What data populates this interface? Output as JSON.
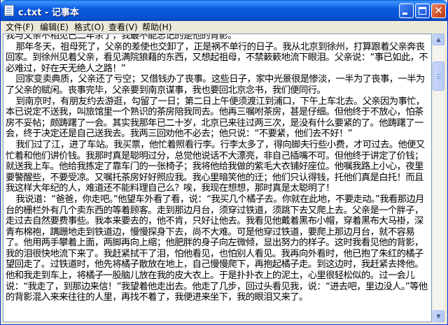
{
  "window": {
    "title": "c.txt - 记事本",
    "minimize_icon": "minimize-icon",
    "maximize_icon": "maximize-icon",
    "close_icon": "close-icon",
    "close_glyph": "✕"
  },
  "menu": {
    "items": [
      "文件(F)",
      "编辑(E)",
      "格式(O)",
      "查看(V)",
      "帮助(H)"
    ]
  },
  "document": {
    "text": "我与父亲不相见已二年余了，我最不能忘记的是他的背影。\n    那年冬天，祖母死了，父亲的差使也交卸了，正是祸不单行的日子。我从北京到徐州，打算跟着父亲奔丧回家。到徐州见着父亲，看见满院狼藉的东西，又想起祖母，不禁簌簌地流下眼泪。父亲说：“事已如此，不必难过，好在天无绝人之路！”\n    回家变卖典质，父亲还了亏空；又借钱办了丧事。这些日子，家中光景很是惨淡，一半为了丧事，一半为了父亲的赋闲。丧事完毕，父亲要到南京谋事，我也要回北京念书，我们便同行。\n    到南京时，有朋友约去游逛，勾留了一日；第二日上午便须渡江到浦口，下午上车北去。父亲因为事忙，本已说定不送我，叫旅馆里一个熟识的茶房陪我同去。他再三嘱咐茶房，甚是仔细。但他终于不放心，怕茶房不妥帖；颇踌躇了一会。其实我那年已二十岁，北京已来往过两三次，是没有什么要紧的了。他踌躇了一会，终于决定还是自己送我去。我两三回劝他不必去；他只说：“不要紧，他们去不好！”\n    我们过了江，进了车站。我买票，他忙着照看行李。行李太多了，得向脚夫行些小费，才可过去。他便又忙着和他们讲价钱。我那时真是聪明过分，总觉他说话不大漂亮，非自己插嘴不可。但他终于讲定了价钱；就送我上车。他给我拣定了靠车门的一张椅子；我将他给我做的紫毛大衣铺好座位。他嘱我路上小心，夜里要警醒些，不要受凉。又嘱托茶房好好照应我。我心里暗笑他的迂；他们只认得钱，托他们真是白托！而且我这样大年纪的人，难道还不能料理自己么？唉，我现在想想，那时真是太聪明了！\n    我说道：“爸爸，你走吧。”他望车外看了看，说：“我买几个橘子去。你就在此地，不要走动。”我看那边月台的栅栏外有几个卖东西的等着顾客。走到那边月台，须穿过铁道，须跳下去又爬上去。父亲是一个胖子，走过去自然要费事些。我本来要去的，他不肯，只好让他去。我看见他戴着黑布小帽，穿着黑布大马褂，深青布棉袍，蹒跚地走到铁道边，慢慢探身下去，尚不大难。可是他穿过铁道，要爬上那边月台，就不容易了。他用两手攀着上面，两脚再向上缩；他肥胖的身子向左微倾，显出努力的样子。这时我看见他的背影，我的泪很快地流下来了。我赶紧拭干了泪，怕他看见，也怕别人看见。我再向外看时，他已抱了朱红的橘子望回走了。过铁道时，他先将橘子散放在地上，自己慢慢爬下，再抱起橘子走。到这边时，我赶紧去搀他。他和我走到车上，将橘子一股脑儿放在我的皮大衣上。于是扑扑衣上的泥土，心里很轻松似的。过一会儿说：“我走了，到那边来信！”我望着他走出去。他走了几步，回过头看见我，说：“进去吧，里边没人。”等他的背影混入来来往往的人里，再找不着了，我便进来坐下，我的眼泪又来了。"
  }
}
